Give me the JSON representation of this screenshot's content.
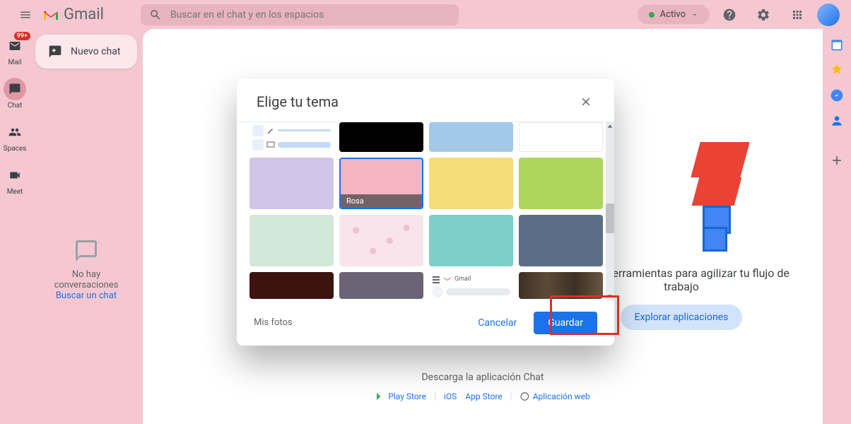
{
  "header": {
    "gmail_text": "Gmail",
    "search_placeholder": "Buscar en el chat y en los espacios",
    "status_label": "Activo"
  },
  "nav": {
    "mail": {
      "label": "Mail",
      "badge": "99+"
    },
    "chat": {
      "label": "Chat"
    },
    "spaces": {
      "label": "Spaces"
    },
    "meet": {
      "label": "Meet"
    }
  },
  "sidebar": {
    "new_chat_label": "Nuevo chat",
    "empty_text": "No hay conversaciones",
    "empty_link": "Buscar un chat"
  },
  "promo": {
    "text": "Obtén herramientas para agilizar tu flujo de trabajo",
    "button_label": "Explorar aplicaciones"
  },
  "download": {
    "title": "Descarga la aplicación Chat",
    "play_store": "Play Store",
    "ios": "iOS",
    "app_store": "App Store",
    "web_app": "Aplicación web"
  },
  "dialog": {
    "title": "Elige tu tema",
    "selected_theme_name": "Rosa",
    "my_photos": "Mis fotos",
    "cancel": "Cancelar",
    "save": "Guardar",
    "preview_gmail_label": "Gmail",
    "themes": {
      "black": "#000000",
      "lightblue": "#a3c9e8",
      "white": "#ffffff",
      "lavender": "#d1c4e9",
      "pink": "#f5b5c0",
      "yellow": "#f5dc7a",
      "lime": "#aed65d",
      "mint": "#d4e8d9",
      "cherry": "#f8e5eb",
      "teal": "#7ecfc9",
      "slate": "#5a6e87",
      "darkred": "#3d1310",
      "purplegray": "#6b6376",
      "wood": "#5c4a36"
    }
  }
}
